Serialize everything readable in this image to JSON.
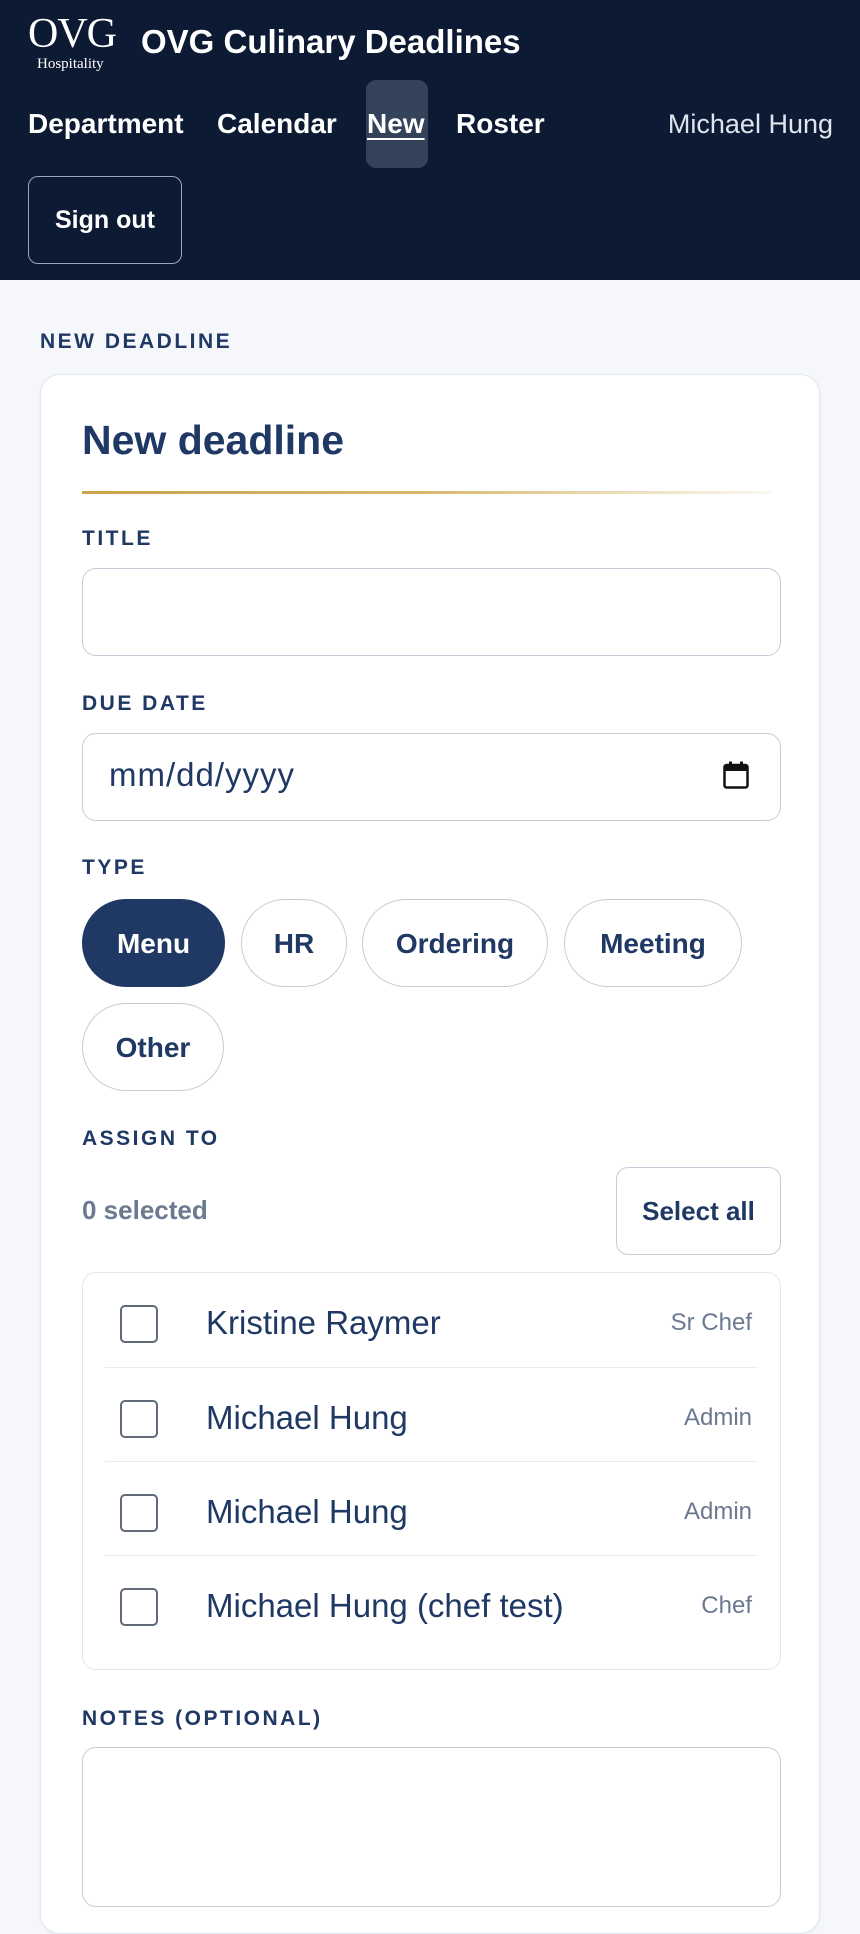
{
  "header": {
    "logo_mark": "OVG",
    "logo_sub": "Hospitality",
    "app_title": "OVG Culinary Deadlines",
    "nav": [
      {
        "label": "Department"
      },
      {
        "label": "Calendar"
      },
      {
        "label": "New",
        "active": true
      },
      {
        "label": "Roster"
      }
    ],
    "user_name": "Michael Hung",
    "signout_label": "Sign out"
  },
  "page": {
    "eyebrow": "NEW DEADLINE",
    "card_title": "New deadline"
  },
  "form": {
    "title_label": "TITLE",
    "title_value": "",
    "due_date_label": "DUE DATE",
    "due_date_placeholder": "mm/dd/yyyy",
    "type_label": "TYPE",
    "types": [
      {
        "label": "Menu",
        "selected": true
      },
      {
        "label": "HR",
        "selected": false
      },
      {
        "label": "Ordering",
        "selected": false
      },
      {
        "label": "Meeting",
        "selected": false
      },
      {
        "label": "Other",
        "selected": false
      }
    ],
    "assign_label": "ASSIGN TO",
    "selected_count": "0 selected",
    "select_all_label": "Select all",
    "assignees": [
      {
        "name": "Kristine Raymer",
        "role": "Sr Chef",
        "checked": false
      },
      {
        "name": "Michael Hung",
        "role": "Admin",
        "checked": false
      },
      {
        "name": "Michael Hung",
        "role": "Admin",
        "checked": false
      },
      {
        "name": "Michael Hung (chef test)",
        "role": "Chef",
        "checked": false
      }
    ],
    "notes_label": "NOTES (OPTIONAL)",
    "notes_value": ""
  },
  "colors": {
    "header_bg": "#0c1a33",
    "primary": "#1f3864",
    "accent_gold": "#c9a24a",
    "muted_text": "#6b7a90"
  }
}
